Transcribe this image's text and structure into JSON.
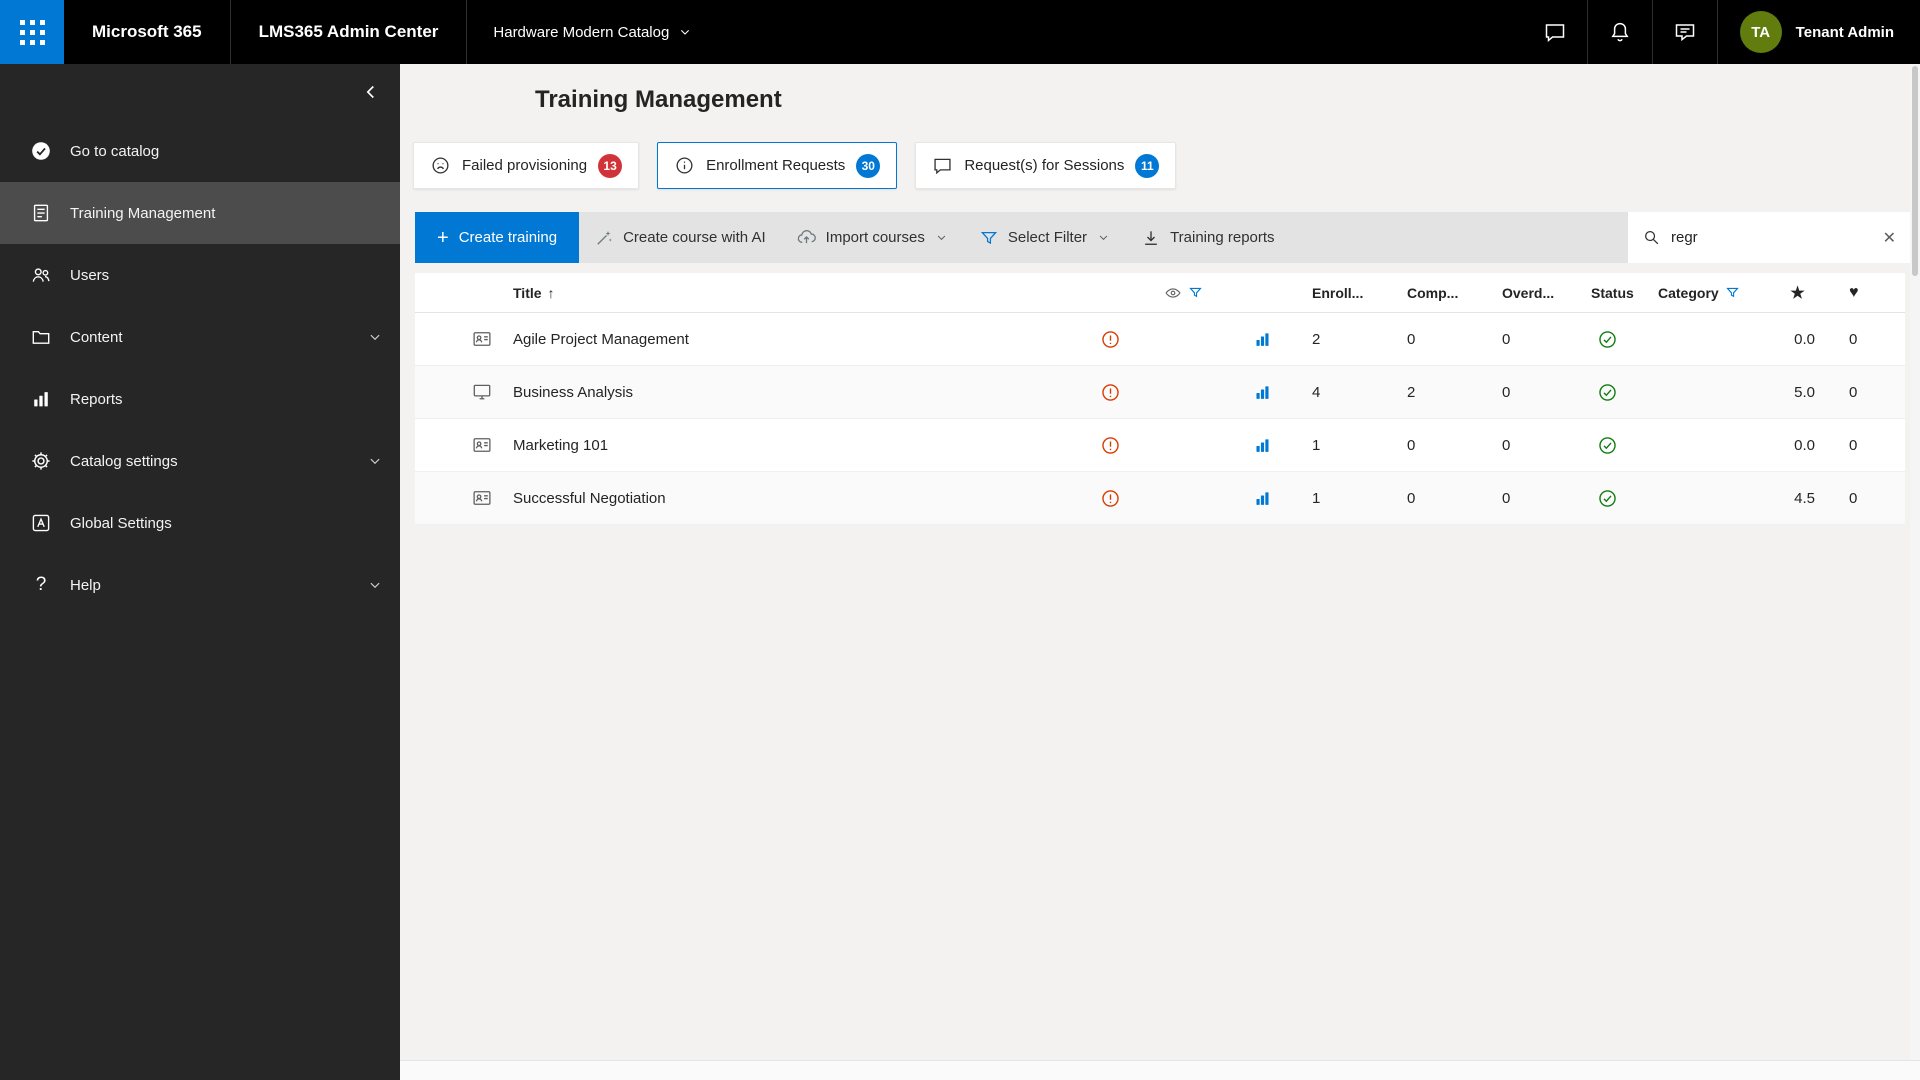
{
  "colors": {
    "accent": "#0078d4",
    "topbar_bg": "#000000",
    "sidebar_bg": "#262626",
    "sidebar_selected_bg": "#4c4c4c",
    "main_bg": "#f3f2f1",
    "toolbar_bg": "#e3e3e3",
    "badge_red": "#d13438",
    "badge_blue": "#0078d4",
    "warning_red": "#d83b01",
    "success_green": "#107c10",
    "avatar_green": "#627d0e"
  },
  "topbar": {
    "product": "Microsoft 365",
    "app_name": "LMS365 Admin Center",
    "catalog_name": "Hardware Modern Catalog",
    "action_icons": [
      "chat-icon",
      "bell-icon",
      "feedback-icon"
    ],
    "avatar_initials": "TA",
    "user_name": "Tenant Admin"
  },
  "sidebar": {
    "items": [
      {
        "label": "Go to catalog",
        "icon": "checkmark-circle-icon",
        "selected": false,
        "expandable": false
      },
      {
        "label": "Training Management",
        "icon": "document-icon",
        "selected": true,
        "expandable": false
      },
      {
        "label": "Users",
        "icon": "people-icon",
        "selected": false,
        "expandable": false
      },
      {
        "label": "Content",
        "icon": "folder-icon",
        "selected": false,
        "expandable": true
      },
      {
        "label": "Reports",
        "icon": "bar-chart-icon",
        "selected": false,
        "expandable": false
      },
      {
        "label": "Catalog settings",
        "icon": "gear-icon",
        "selected": false,
        "expandable": true
      },
      {
        "label": "Global Settings",
        "icon": "global-settings-icon",
        "selected": false,
        "expandable": false
      },
      {
        "label": "Help",
        "icon": "question-icon",
        "selected": false,
        "expandable": true
      }
    ]
  },
  "page": {
    "title": "Training Management"
  },
  "tabs": [
    {
      "label": "Failed provisioning",
      "count": "13",
      "badge_color": "#d13438",
      "icon": "sad-face-icon",
      "selected": false
    },
    {
      "label": "Enrollment Requests",
      "count": "30",
      "badge_color": "#0078d4",
      "icon": "info-icon",
      "selected": true
    },
    {
      "label": "Request(s) for Sessions",
      "count": "11",
      "badge_color": "#0078d4",
      "icon": "chat-bubble-icon",
      "selected": false
    }
  ],
  "toolbar": {
    "create_training_label": "Create training",
    "create_course_ai_label": "Create course with AI",
    "import_courses_label": "Import courses",
    "select_filter_label": "Select Filter",
    "training_reports_label": "Training reports",
    "search": {
      "value": "regr",
      "clear_label": "✕"
    }
  },
  "table": {
    "headers": {
      "title": "Title",
      "sort_indicator": "↑",
      "enrolled": "Enroll...",
      "completed": "Comp...",
      "overdue": "Overd...",
      "status": "Status",
      "category": "Category",
      "rating": "★",
      "favorites": "♥"
    },
    "rows": [
      {
        "title": "Agile Project Management",
        "type_icon": "id-card",
        "warning_icon": "alert-circle",
        "stats_icon": "bar-chart",
        "enrolled": "2",
        "completed": "0",
        "overdue": "0",
        "status_icon": "check-circle-green",
        "rating": "0.0",
        "favorites": "0"
      },
      {
        "title": "Business Analysis",
        "type_icon": "monitor",
        "warning_icon": "alert-circle",
        "stats_icon": "bar-chart",
        "enrolled": "4",
        "completed": "2",
        "overdue": "0",
        "status_icon": "check-circle-green",
        "rating": "5.0",
        "favorites": "0"
      },
      {
        "title": "Marketing 101",
        "type_icon": "id-card",
        "warning_icon": "alert-circle",
        "stats_icon": "bar-chart",
        "enrolled": "1",
        "completed": "0",
        "overdue": "0",
        "status_icon": "check-circle-green",
        "rating": "0.0",
        "favorites": "0"
      },
      {
        "title": "Successful Negotiation",
        "type_icon": "id-card",
        "warning_icon": "alert-circle",
        "stats_icon": "bar-chart",
        "enrolled": "1",
        "completed": "0",
        "overdue": "0",
        "status_icon": "check-circle-green",
        "rating": "4.5",
        "favorites": "0"
      }
    ]
  }
}
